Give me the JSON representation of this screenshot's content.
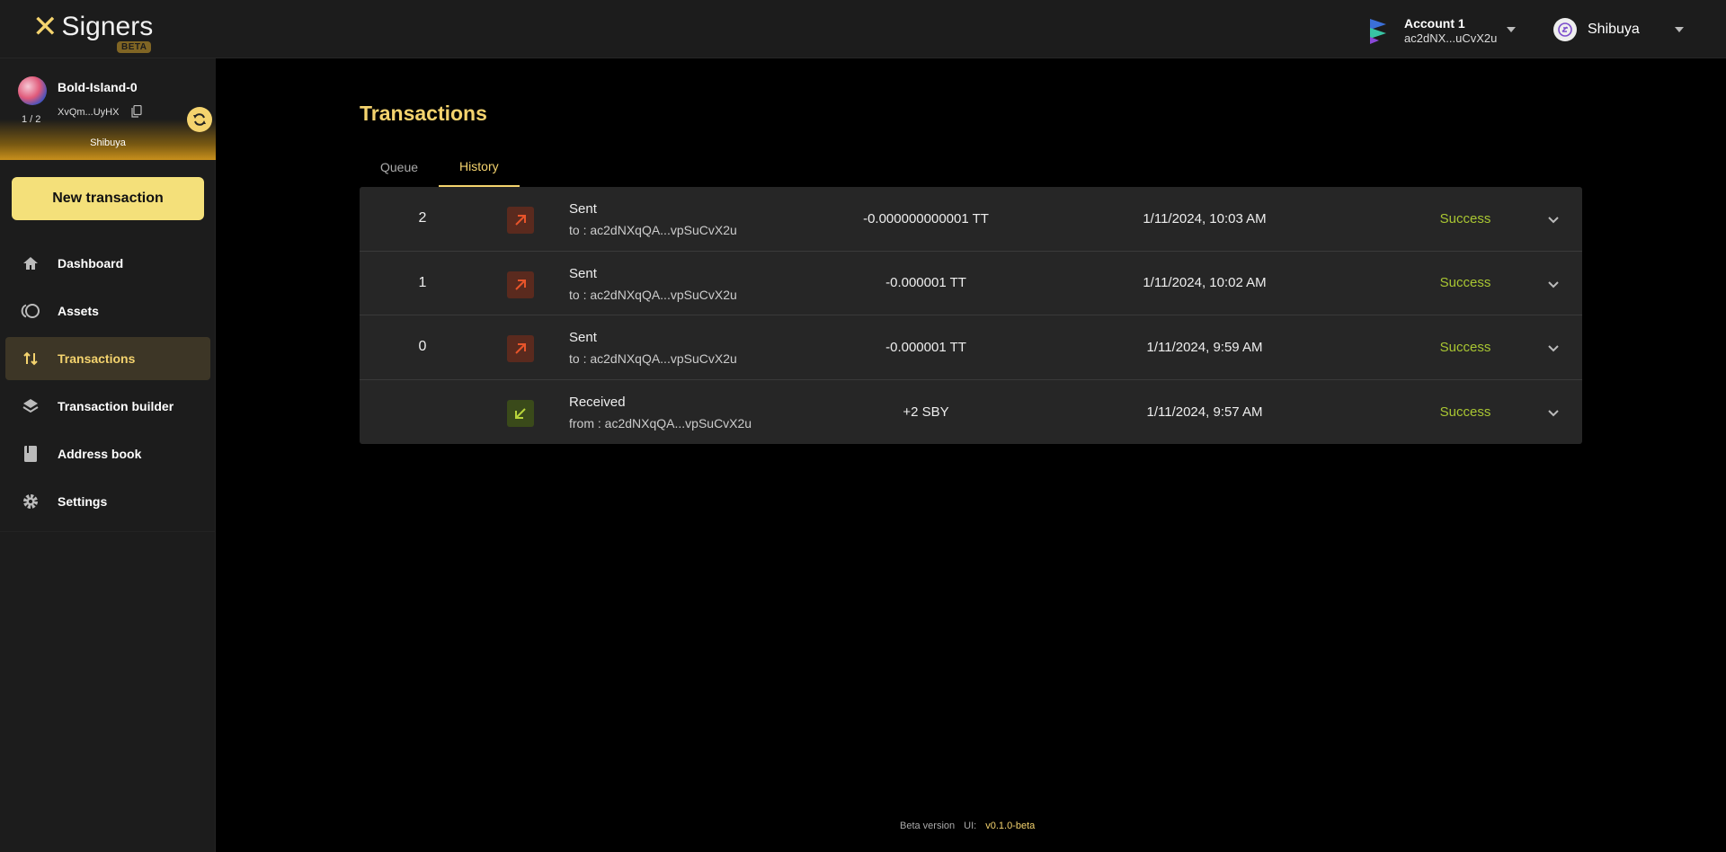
{
  "app": {
    "logo_text": "Signers",
    "logo_badge": "BETA"
  },
  "header": {
    "account": {
      "name": "Account 1",
      "address": "ac2dNX...uCvX2u"
    },
    "network": {
      "name": "Shibuya"
    }
  },
  "sidebar": {
    "wallet": {
      "name": "Bold-Island-0",
      "address": "XvQm...UyHX",
      "signers_count": "1 / 2",
      "network": "Shibuya"
    },
    "new_transaction_label": "New transaction",
    "items": [
      {
        "label": "Dashboard",
        "icon": "home-icon",
        "active": false
      },
      {
        "label": "Assets",
        "icon": "coins-icon",
        "active": false
      },
      {
        "label": "Transactions",
        "icon": "arrows-up-down-icon",
        "active": true
      },
      {
        "label": "Transaction builder",
        "icon": "layers-icon",
        "active": false
      },
      {
        "label": "Address book",
        "icon": "book-icon",
        "active": false
      },
      {
        "label": "Settings",
        "icon": "gear-icon",
        "active": false
      }
    ]
  },
  "main": {
    "title": "Transactions",
    "tabs": [
      {
        "label": "Queue",
        "active": false
      },
      {
        "label": "History",
        "active": true
      }
    ],
    "transactions": [
      {
        "nonce": "2",
        "kind": "Sent",
        "party": "to : ac2dNXqQA...vpSuCvX2u",
        "amount": "-0.000000000001 TT",
        "date": "1/11/2024, 10:03 AM",
        "status": "Success",
        "direction": "sent"
      },
      {
        "nonce": "1",
        "kind": "Sent",
        "party": "to : ac2dNXqQA...vpSuCvX2u",
        "amount": "-0.000001 TT",
        "date": "1/11/2024, 10:02 AM",
        "status": "Success",
        "direction": "sent"
      },
      {
        "nonce": "0",
        "kind": "Sent",
        "party": "to : ac2dNXqQA...vpSuCvX2u",
        "amount": "-0.000001 TT",
        "date": "1/11/2024, 9:59 AM",
        "status": "Success",
        "direction": "sent"
      },
      {
        "nonce": "",
        "kind": "Received",
        "party": "from : ac2dNXqQA...vpSuCvX2u",
        "amount": "+2 SBY",
        "date": "1/11/2024, 9:57 AM",
        "status": "Success",
        "direction": "received"
      }
    ]
  },
  "footer": {
    "beta_label": "Beta version",
    "ui_label": "UI:",
    "ui_version": "v0.1.0-beta"
  },
  "colors": {
    "accent": "#f4d36e",
    "success": "#a9c632",
    "sent": "#e8542a",
    "received": "#b8d43a"
  }
}
